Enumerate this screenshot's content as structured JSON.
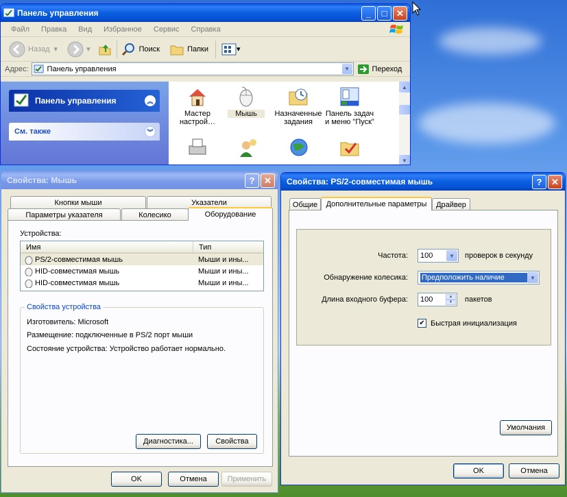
{
  "desktop": {},
  "cp_window": {
    "title": "Панель управления",
    "menu": [
      "Файл",
      "Правка",
      "Вид",
      "Избранное",
      "Сервис",
      "Справка"
    ],
    "toolbar": {
      "back": "Назад",
      "search": "Поиск",
      "folders": "Папки"
    },
    "address_label": "Адрес:",
    "address_value": "Панель управления",
    "go_label": "Переход",
    "task_panes": [
      "Панель управления",
      "См. также"
    ],
    "icons_row1": [
      {
        "label": "Мастер настрой…",
        "icon": "network-wizard-icon"
      },
      {
        "label": "Мышь",
        "icon": "mouse-icon"
      },
      {
        "label": "Назначенные задания",
        "icon": "scheduled-tasks-icon"
      },
      {
        "label": "Панель задач и меню \"Пуск\"",
        "icon": "taskbar-icon"
      }
    ],
    "icons_row2": [
      "printers-icon",
      "user-accounts-icon",
      "internet-options-icon",
      "folder-options-icon"
    ]
  },
  "mouse_props": {
    "title": "Свойства: Мышь",
    "tabs_row1": [
      "Кнопки мыши",
      "Указатели"
    ],
    "tabs_row2": [
      "Параметры указателя",
      "Колесико",
      "Оборудование"
    ],
    "devices_label": "Устройства:",
    "columns": [
      "Имя",
      "Тип"
    ],
    "devices": [
      {
        "name": "PS/2-совместимая мышь",
        "type": "Мыши и ины..."
      },
      {
        "name": "HID-совместимая мышь",
        "type": "Мыши и ины..."
      },
      {
        "name": "HID-совместимая мышь",
        "type": "Мыши и ины..."
      }
    ],
    "group_title": "Свойства устройства",
    "manufacturer": "Изготовитель: Microsoft",
    "location": "Размещение: подключенные в PS/2 порт мыши",
    "status": "Состояние устройства: Устройство работает нормально.",
    "diag_button": "Диагностика...",
    "props_button": "Свойства",
    "ok": "OK",
    "cancel": "Отмена",
    "apply": "Применить"
  },
  "ps2_props": {
    "title": "Свойства: PS/2-совместимая мышь",
    "tabs": [
      "Общие",
      "Дополнительные параметры",
      "Драйвер"
    ],
    "rate_label": "Частота:",
    "rate_value": "100",
    "rate_unit": "проверок в секунду",
    "wheel_label": "Обнаружение колесика:",
    "wheel_value": "Предположить наличие",
    "buffer_label": "Длина входного буфера:",
    "buffer_value": "100",
    "buffer_unit": "пакетов",
    "fast_init_label": "Быстрая инициализация",
    "fast_init_checked": true,
    "defaults_button": "Умолчания",
    "ok": "OK",
    "cancel": "Отмена"
  }
}
